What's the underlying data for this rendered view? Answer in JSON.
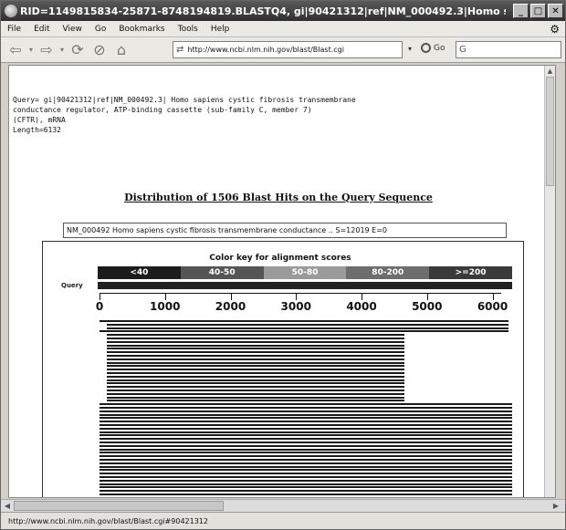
{
  "window": {
    "title": "RID=1149815834-25871-8748194819.BLASTQ4, gi|90421312|ref|NM_000492.3|Homo s..."
  },
  "menu": [
    "File",
    "Edit",
    "View",
    "Go",
    "Bookmarks",
    "Tools",
    "Help"
  ],
  "toolbar": {
    "url": "http://www.ncbi.nlm.nih.gov/blast/Blast.cgi",
    "go_label": "Go",
    "search_text": "G"
  },
  "page": {
    "query_text": "Query= gi|90421312|ref|NM_000492.3| Homo sapiens cystic fibrosis transmembrane\nconductance regulator, ATP-binding cassette (sub-family C, member 7)\n(CFTR), mRNA\nLength=6132",
    "distribution_title": "Distribution of 1506 Blast Hits on the Query Sequence",
    "hit_description": "NM_000492 Homo sapiens cystic fibrosis transmembrane conductance .. S=12019 E=0"
  },
  "graphic": {
    "color_key_title": "Color key for alignment scores",
    "color_key": [
      {
        "label": "<40",
        "color": "#1c1c1c"
      },
      {
        "label": "40-50",
        "color": "#555555"
      },
      {
        "label": "50-80",
        "color": "#9a9a9a"
      },
      {
        "label": "80-200",
        "color": "#6d6d6d"
      },
      {
        "label": ">=200",
        "color": "#3a3a3a"
      }
    ],
    "query_label": "Query",
    "axis_ticks": [
      "0",
      "1000",
      "2000",
      "3000",
      "4000",
      "5000",
      "6000"
    ],
    "axis_max": 6132
  },
  "status": {
    "text": "http://www.ncbi.nlm.nih.gov/blast/Blast.cgi#90421312"
  }
}
